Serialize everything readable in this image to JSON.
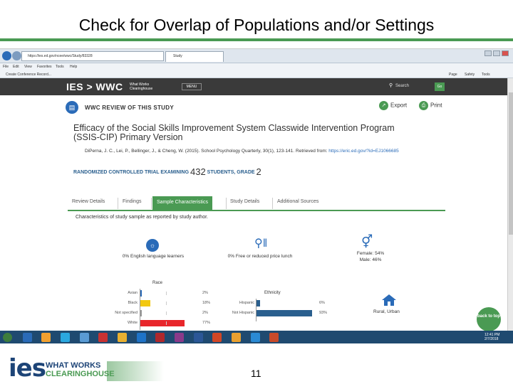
{
  "slide": {
    "title": "Check for Overlap of Populations and/or Settings",
    "page_number": "11"
  },
  "browser": {
    "address": "https://ies.ed.gov/ncee/wwc/Study/83328",
    "tab_title": "Study",
    "menu_items": [
      "File",
      "Edit",
      "View",
      "Favorites",
      "Tools",
      "Help"
    ],
    "favorite": "Create Conference Record...",
    "toolbar_items": [
      "Page",
      "Safety",
      "Tools"
    ]
  },
  "site": {
    "logo": "IES > WWC",
    "logo_sub": "What Works Clearinghouse",
    "menu_label": "MENU",
    "search_placeholder": "Search",
    "go_label": "Go"
  },
  "review": {
    "heading": "WWC REVIEW OF THIS STUDY",
    "export_label": "Export",
    "print_label": "Print",
    "study_title": "Efficacy of the Social Skills Improvement System Classwide Intervention Program (SSIS-CIP) Primary Version",
    "citation": "DiPerna, J. C., Lei, P., Bellinger, J., & Cheng, W. (2015). School Psychology Quarterly, 30(1), 123-141. Retrieved from:",
    "citation_link": "https://eric.ed.gov/?id=EJ1066685",
    "design": "RANDOMIZED CONTROLLED TRIAL",
    "examining": "EXAMINING",
    "students_count": "432",
    "students_label": "STUDENTS, GRADE",
    "grade": "2"
  },
  "tabs": [
    "Review Details",
    "Findings",
    "Sample Characteristics",
    "Study Details",
    "Additional Sources"
  ],
  "characteristics": {
    "heading": "Characteristics of study sample as reported by study author.",
    "ell": "0% English language learners",
    "lunch": "0% Free or reduced price lunch",
    "female": "Female: 54%",
    "male": "Male: 46%",
    "locale": "Rural, Urban",
    "race_title": "Race",
    "ethnicity_title": "Ethnicity"
  },
  "chart_data": [
    {
      "type": "bar",
      "title": "Race",
      "categories": [
        "Asian",
        "Black",
        "Not specified",
        "White"
      ],
      "values": [
        2,
        18,
        2,
        77
      ],
      "labels": [
        "2%",
        "18%",
        "2%",
        "77%"
      ],
      "colors": [
        "#2a6bb8",
        "#f2c811",
        "#999999",
        "#e8262b"
      ]
    },
    {
      "type": "bar",
      "title": "Ethnicity",
      "categories": [
        "Hispanic",
        "Not Hispanic"
      ],
      "values": [
        6,
        93
      ],
      "labels": [
        "6%",
        "93%"
      ],
      "colors": [
        "#2a5f8e",
        "#2a5f8e"
      ]
    }
  ],
  "back_to_top": "back to top",
  "taskbar": {
    "time": "12:41 PM",
    "date": "2/7/2018"
  },
  "footer": {
    "logo": "ies",
    "line1": "WHAT WORKS",
    "line2": "CLEARINGHOUSE"
  }
}
